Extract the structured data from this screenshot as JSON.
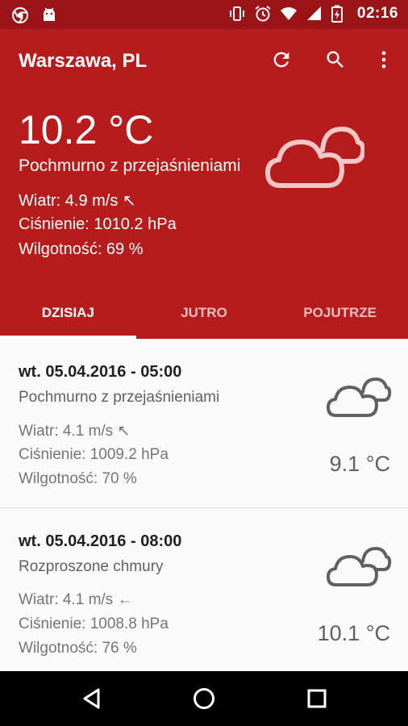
{
  "status_bar": {
    "time": "02:16",
    "icons_left": [
      "chrome-icon",
      "android-icon"
    ],
    "icons_right": [
      "vibrate-icon",
      "alarm-icon",
      "wifi-icon",
      "signal-icon",
      "battery-charging-icon"
    ]
  },
  "toolbar": {
    "title": "Warszawa, PL",
    "actions": [
      "refresh-icon",
      "search-icon",
      "more-vert-icon"
    ]
  },
  "current": {
    "temp": "10.2 °C",
    "description": "Pochmurno z przejaśnieniami",
    "wind": "Wiatr: 4.9 m/s ↖",
    "pressure": "Ciśnienie: 1010.2 hPa",
    "humidity": "Wilgotność: 69 %",
    "icon": "clouds-icon"
  },
  "tabs": [
    {
      "label": "DZISIAJ",
      "active": true
    },
    {
      "label": "JUTRO",
      "active": false
    },
    {
      "label": "POJUTRZE",
      "active": false
    }
  ],
  "forecast": [
    {
      "datetime": "wt. 05.04.2016 - 05:00",
      "description": "Pochmurno z przejaśnieniami",
      "wind": "Wiatr: 4.1 m/s ↖",
      "pressure": "Ciśnienie: 1009.2 hPa",
      "humidity": "Wilgotność: 70 %",
      "temp": "9.1 °C",
      "icon": "clouds-icon"
    },
    {
      "datetime": "wt. 05.04.2016 - 08:00",
      "description": "Rozproszone chmury",
      "wind": "Wiatr: 4.1 m/s ←",
      "pressure": "Ciśnienie: 1008.8 hPa",
      "humidity": "Wilgotność: 76 %",
      "temp": "10.1 °C",
      "icon": "clouds-icon"
    }
  ],
  "colors": {
    "primary": "#b71c1c",
    "status_bar": "#9b1418",
    "list_background": "#fafafa"
  }
}
